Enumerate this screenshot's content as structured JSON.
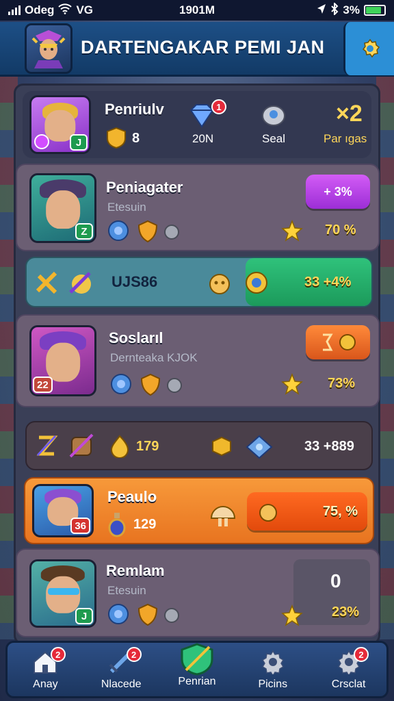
{
  "status": {
    "carrier": "Odeg",
    "network": "VG",
    "time": "1901M",
    "battery": "3%"
  },
  "header": {
    "title": "DARTENGAKAR PEMI JAN"
  },
  "profile": {
    "name": "Penriulv",
    "rank": "8",
    "gem_label": "20N",
    "gem_badge": "1",
    "seal_label": "Seal",
    "multiplier": "×2",
    "multiplier_label": "Par ıgas"
  },
  "rows": [
    {
      "name": "Peniagater",
      "subtitle": "Etesuin",
      "level": "Z",
      "percent": "70 %",
      "action": "+ 3%"
    },
    {
      "name": "Soslarıl",
      "subtitle": "Dernteaka KJOK",
      "level": "22",
      "percent": "73%"
    },
    {
      "name": "Peaulo",
      "level": "36",
      "count": "129",
      "percent": "75, %"
    },
    {
      "name": "Remlam",
      "subtitle": "Etesuin",
      "level": "J",
      "score": "0",
      "percent": "23%"
    }
  ],
  "strips": [
    {
      "label": "UJS86",
      "value": "33 +4%"
    },
    {
      "count": "179",
      "value": "33 +889"
    }
  ],
  "nav": [
    {
      "label": "Anay",
      "badge": "2",
      "icon": "home-icon"
    },
    {
      "label": "Nlacede",
      "badge": "2",
      "icon": "sword-icon"
    },
    {
      "label": "Penrian",
      "badge": "",
      "icon": "shield-icon"
    },
    {
      "label": "Picins",
      "badge": "",
      "icon": "gear-icon"
    },
    {
      "label": "Crsclat",
      "badge": "2",
      "icon": "gear-icon"
    }
  ],
  "colors": {
    "accent_orange": "#f6892d",
    "accent_green": "#25b46b",
    "accent_purple": "#b33be0",
    "gold": "#ffd659"
  }
}
